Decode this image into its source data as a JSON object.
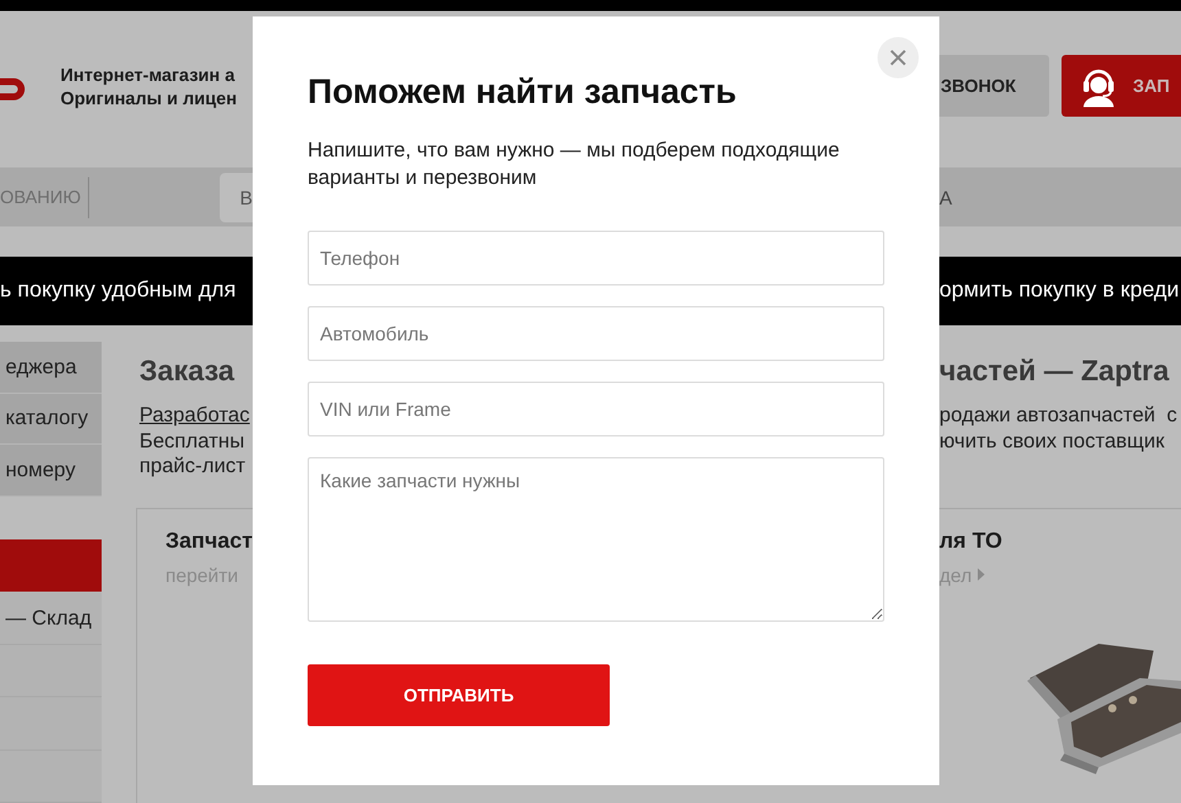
{
  "header": {
    "tagline_lines": [
      "Интернет-магазин а",
      "Оригиналы и лицен"
    ],
    "callback_button": "ЗВОНОК",
    "order_button": "ЗАП"
  },
  "nav": {
    "left_item": "ОВАНИЮ",
    "box_text": "В",
    "right_item": "А"
  },
  "promo_strip": {
    "left_text": "ь покупку удобным для",
    "right_text": "ормить покупку в креди"
  },
  "sidebar": {
    "items": [
      {
        "label": "еджера",
        "selected": false
      },
      {
        "label": "каталогу",
        "selected": false
      },
      {
        "label": "номеру",
        "selected": false
      },
      {
        "selected": true
      },
      {
        "label": "— Склад",
        "selected": false
      }
    ]
  },
  "content": {
    "heading_left": "Заказа",
    "heading_right": "частей — Zaptra",
    "link": "Разработас",
    "lines_left": [
      "Бесплатны",
      "прайс-лист"
    ],
    "lines_right": [
      "родажи автозапчастей  с",
      "ючить своих поставщик"
    ]
  },
  "cards": [
    {
      "title": "Запчаст",
      "link": "перейти"
    },
    {
      "title": "ля ТО",
      "link": "дел",
      "kind": "picture"
    }
  ],
  "modal": {
    "title": "Поможем найти запчасть",
    "subtitle": "Напишите, что вам нужно — мы подберем подходящие варианты и перезвоним",
    "fields": [
      {
        "kind": "input",
        "placeholder": "Телефон"
      },
      {
        "kind": "input",
        "placeholder": "Автомобиль"
      },
      {
        "kind": "input",
        "placeholder": "VIN или Frame"
      },
      {
        "kind": "textarea",
        "placeholder": "Какие запчасти нужны"
      }
    ],
    "submit": "ОТПРАВИТЬ"
  }
}
